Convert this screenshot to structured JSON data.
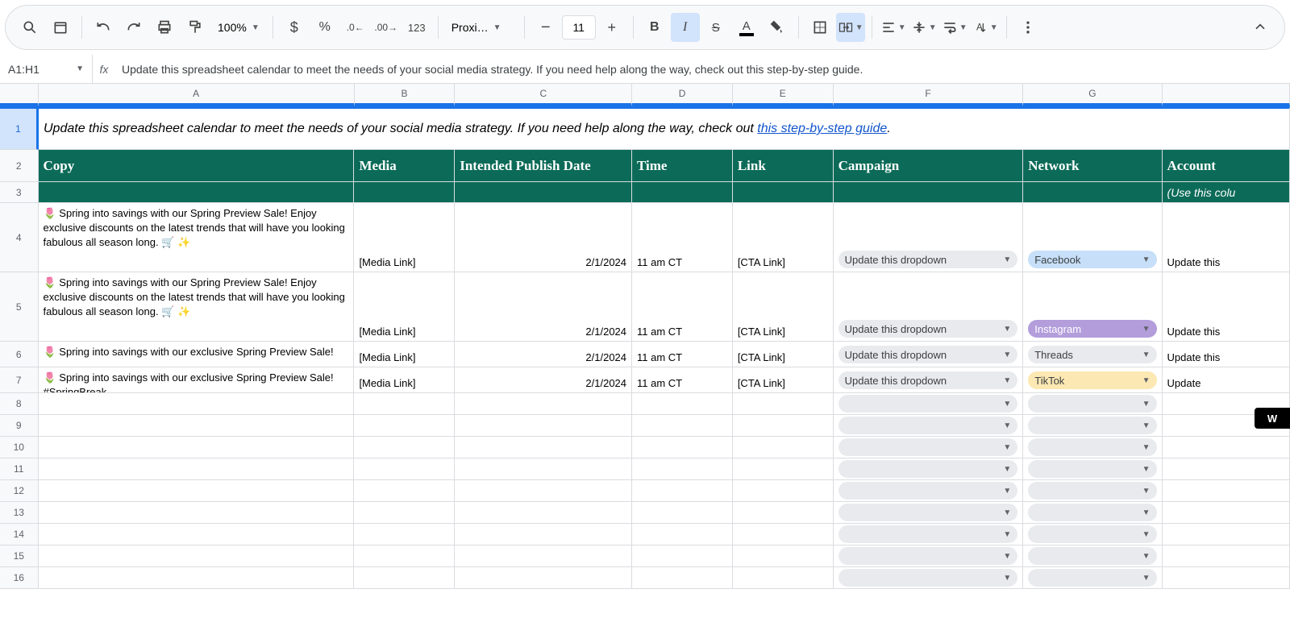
{
  "toolbar": {
    "zoom": "100%",
    "font_name": "Proxi…",
    "font_size": "11",
    "number_format_123": "123"
  },
  "nameBox": "A1:H1",
  "formulaBar": "Update this spreadsheet calendar to meet the needs of your social media strategy. If you need help along the way, check out this step-by-step guide.",
  "columns": [
    "A",
    "B",
    "C",
    "D",
    "E",
    "F",
    "G"
  ],
  "row1": {
    "text_before_link": "Update this spreadsheet calendar to meet the needs of your social media strategy. If you need help along the way, check out ",
    "link_text": "this step-by-step guide",
    "text_after_link": "."
  },
  "headers": {
    "A": "Copy",
    "B": "Media",
    "C": "Intended Publish Date",
    "D": "Time",
    "E": "Link",
    "F": "Campaign",
    "G": "Network",
    "H": "Account"
  },
  "row3_H": "(Use this colu",
  "dataRows": [
    {
      "copy": "🌷  Spring into savings with our Spring Preview Sale! Enjoy exclusive discounts on the latest trends that will have you looking fabulous all season long. 🛒 ✨",
      "media": "[Media Link]",
      "date": "2/1/2024",
      "time": "11 am CT",
      "link": "[CTA Link]",
      "campaign": "Update this dropdown",
      "network": "Facebook",
      "network_class": "fb",
      "account": "Update this"
    },
    {
      "copy": "🌷  Spring into savings with our Spring Preview Sale! Enjoy exclusive discounts on the latest trends that will have you looking fabulous all season long. 🛒 ✨",
      "media": "[Media Link]",
      "date": "2/1/2024",
      "time": "11 am CT",
      "link": "[CTA Link]",
      "campaign": "Update this dropdown",
      "network": "Instagram",
      "network_class": "ig",
      "account": "Update this"
    },
    {
      "copy": "🌷  Spring into savings with our exclusive Spring Preview Sale!",
      "media": "[Media Link]",
      "date": "2/1/2024",
      "time": "11 am CT",
      "link": "[CTA Link]",
      "campaign": "Update this dropdown",
      "network": "Threads",
      "network_class": "th",
      "account": "Update this"
    },
    {
      "copy": "🌷  Spring into savings with our exclusive Spring Preview Sale! #SpringBreak",
      "media": "[Media Link]",
      "date": "2/1/2024",
      "time": "11 am CT",
      "link": "[CTA Link]",
      "campaign": "Update this dropdown",
      "network": "TikTok",
      "network_class": "tt",
      "account": "Update"
    }
  ],
  "emptyRowNums": [
    8,
    9,
    10,
    11,
    12,
    13,
    14,
    15,
    16
  ],
  "badge": "W"
}
